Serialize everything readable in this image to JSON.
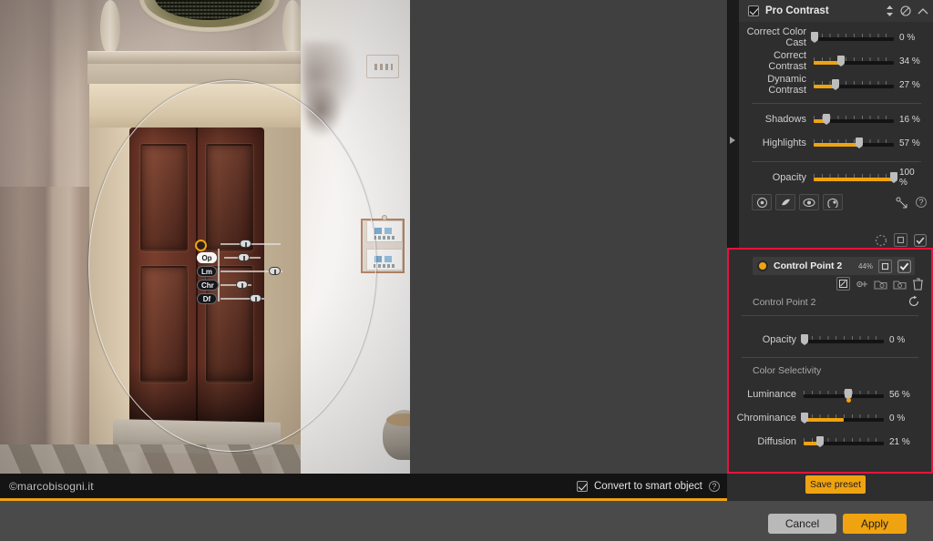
{
  "app": {
    "canvas_background": "#404040",
    "accent_color": "#f0a310",
    "highlight_border_color": "#e8123c"
  },
  "photo": {
    "copyright": "©marcobisogni.it",
    "description": "Building facade with wooden double door, stone surround, oculus window above and white wall to the right"
  },
  "control_point_overlay": {
    "point_label": "control-point",
    "rows": [
      {
        "key": "Op",
        "label": "Op",
        "active": true,
        "handle_pct": 96
      },
      {
        "key": "Lm",
        "label": "Lm",
        "active": false,
        "handle_pct": 28
      },
      {
        "key": "Chr",
        "label": "Chr",
        "active": false,
        "handle_pct": 98
      },
      {
        "key": "Df",
        "label": "Df",
        "active": false,
        "handle_pct": 38
      }
    ]
  },
  "photo_footer": {
    "smart_object_label": "Convert to smart object",
    "smart_object_checked": true,
    "help_icon": "?"
  },
  "bottom_bar": {
    "cancel_label": "Cancel",
    "apply_label": "Apply"
  },
  "filter_panel": {
    "title": "Pro Contrast",
    "enabled": true,
    "header_icons": [
      "updown-arrows-icon",
      "reset-circle-icon",
      "chevron-up-icon"
    ],
    "sliders": [
      {
        "name": "correct-color-cast",
        "label_line1": "Correct Color",
        "label_line2": "Cast",
        "value": "0 %",
        "pct": 1,
        "fill": 0
      },
      {
        "name": "correct-contrast",
        "label_line1": "Correct",
        "label_line2": "Contrast",
        "value": "34 %",
        "pct": 34,
        "fill": 34
      },
      {
        "name": "dynamic-contrast",
        "label_line1": "Dynamic",
        "label_line2": "Contrast",
        "value": "27 %",
        "pct": 27,
        "fill": 27
      },
      {
        "name": "shadows",
        "label_line1": "Shadows",
        "label_line2": "",
        "value": "16 %",
        "pct": 16,
        "fill": 16
      },
      {
        "name": "highlights",
        "label_line1": "Highlights",
        "label_line2": "",
        "value": "57 %",
        "pct": 57,
        "fill": 57
      },
      {
        "name": "opacity",
        "label_line1": "Opacity",
        "label_line2": "",
        "value": "100 %",
        "pct": 100,
        "fill": 100
      }
    ],
    "tool_icons": [
      "brush-icon",
      "eraser-icon",
      "eye-icon",
      "hand-icon"
    ],
    "tool_right_icons": [
      "control-point-icon",
      "help-icon"
    ]
  },
  "control_point_panel": {
    "header_title": "Control Point 2",
    "header_percent": "44%",
    "header_icons": [
      "duplicate-icon",
      "visibility-check-icon"
    ],
    "tool_icons": [
      "edit-mask-icon",
      "add-point-icon",
      "group-icon",
      "ungroup-icon",
      "trash-icon"
    ],
    "subtitle": "Control Point 2",
    "reset_icon": "reset-arrow-icon",
    "opacity": {
      "label": "Opacity",
      "value": "0 %",
      "pct": 1,
      "fill": 0
    },
    "section_label": "Color Selectivity",
    "sliders": [
      {
        "name": "luminance",
        "label": "Luminance",
        "value": "56 %",
        "pct": 56,
        "fill": 0,
        "dot_pct": 56
      },
      {
        "name": "chrominance",
        "label": "Chrominance",
        "value": "0 %",
        "pct": 1,
        "fill": 50,
        "dot_pct": null
      },
      {
        "name": "diffusion",
        "label": "Diffusion",
        "value": "21 %",
        "pct": 21,
        "fill": 21,
        "dot_pct": null
      }
    ],
    "save_preset_label": "Save preset"
  }
}
